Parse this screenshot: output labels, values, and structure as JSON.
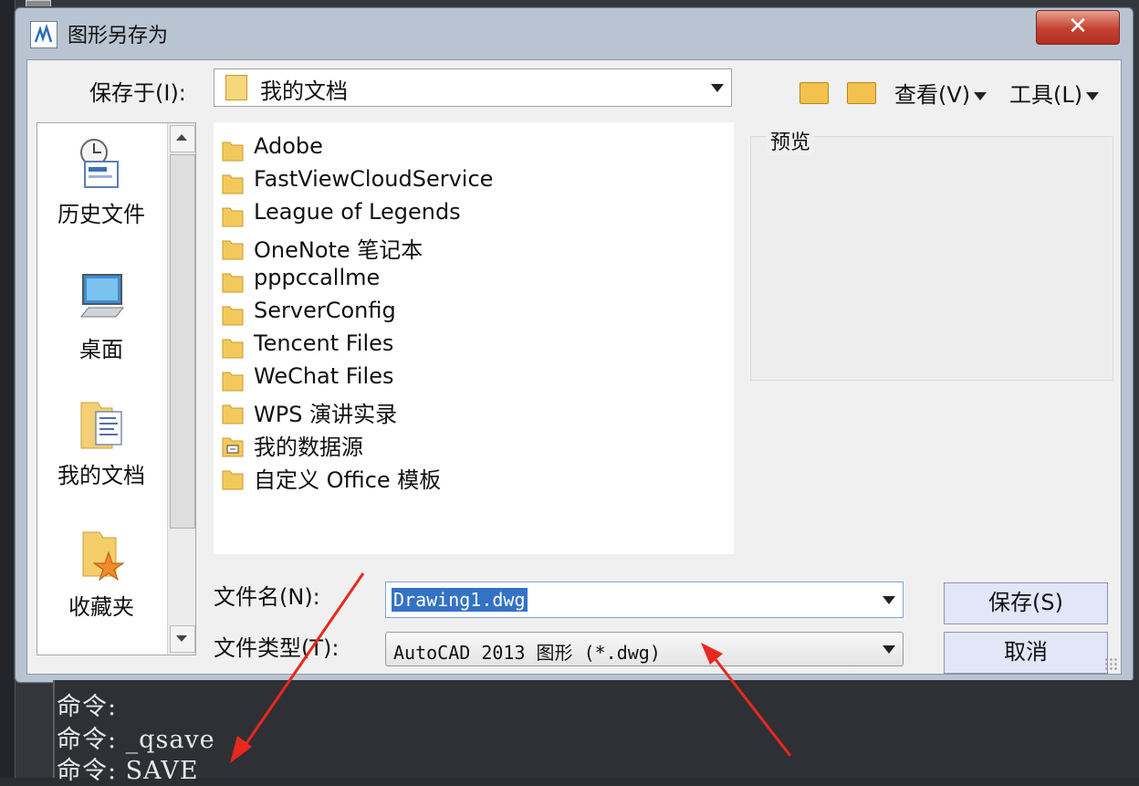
{
  "dialog": {
    "title": "图形另存为",
    "close_label": "✕"
  },
  "save_in": {
    "label": "保存于(I):",
    "value": "我的文档"
  },
  "toolbar": {
    "view_label": "查看(V)",
    "tools_label": "工具(L)"
  },
  "places": [
    {
      "label": "历史文件"
    },
    {
      "label": "桌面"
    },
    {
      "label": "我的文档"
    },
    {
      "label": "收藏夹"
    }
  ],
  "files": [
    {
      "name": "Adobe",
      "icon": "folder-icon"
    },
    {
      "name": "FastViewCloudService",
      "icon": "folder-icon"
    },
    {
      "name": "League of Legends",
      "icon": "folder-icon"
    },
    {
      "name": "OneNote 笔记本",
      "icon": "folder-icon"
    },
    {
      "name": "pppccallme",
      "icon": "folder-icon"
    },
    {
      "name": "ServerConfig",
      "icon": "folder-icon"
    },
    {
      "name": "Tencent Files",
      "icon": "folder-icon"
    },
    {
      "name": "WeChat Files",
      "icon": "folder-icon"
    },
    {
      "name": "WPS 演讲实录",
      "icon": "folder-icon"
    },
    {
      "name": "我的数据源",
      "icon": "datasource-folder-icon"
    },
    {
      "name": "自定义 Office 模板",
      "icon": "folder-icon"
    }
  ],
  "preview": {
    "label": "预览"
  },
  "filename": {
    "label": "文件名(N):",
    "value": "Drawing1.dwg"
  },
  "filetype": {
    "label": "文件类型(T):",
    "value": "AutoCAD 2013 图形 (*.dwg)"
  },
  "buttons": {
    "save": "保存(S)",
    "cancel": "取消"
  },
  "command_lines": [
    "命令:",
    "命令: _qsave",
    "命令: SAVE"
  ],
  "colors": {
    "annotation_arrow": "#e8281e",
    "selection": "#3372c4",
    "close_button": "#c44030"
  }
}
